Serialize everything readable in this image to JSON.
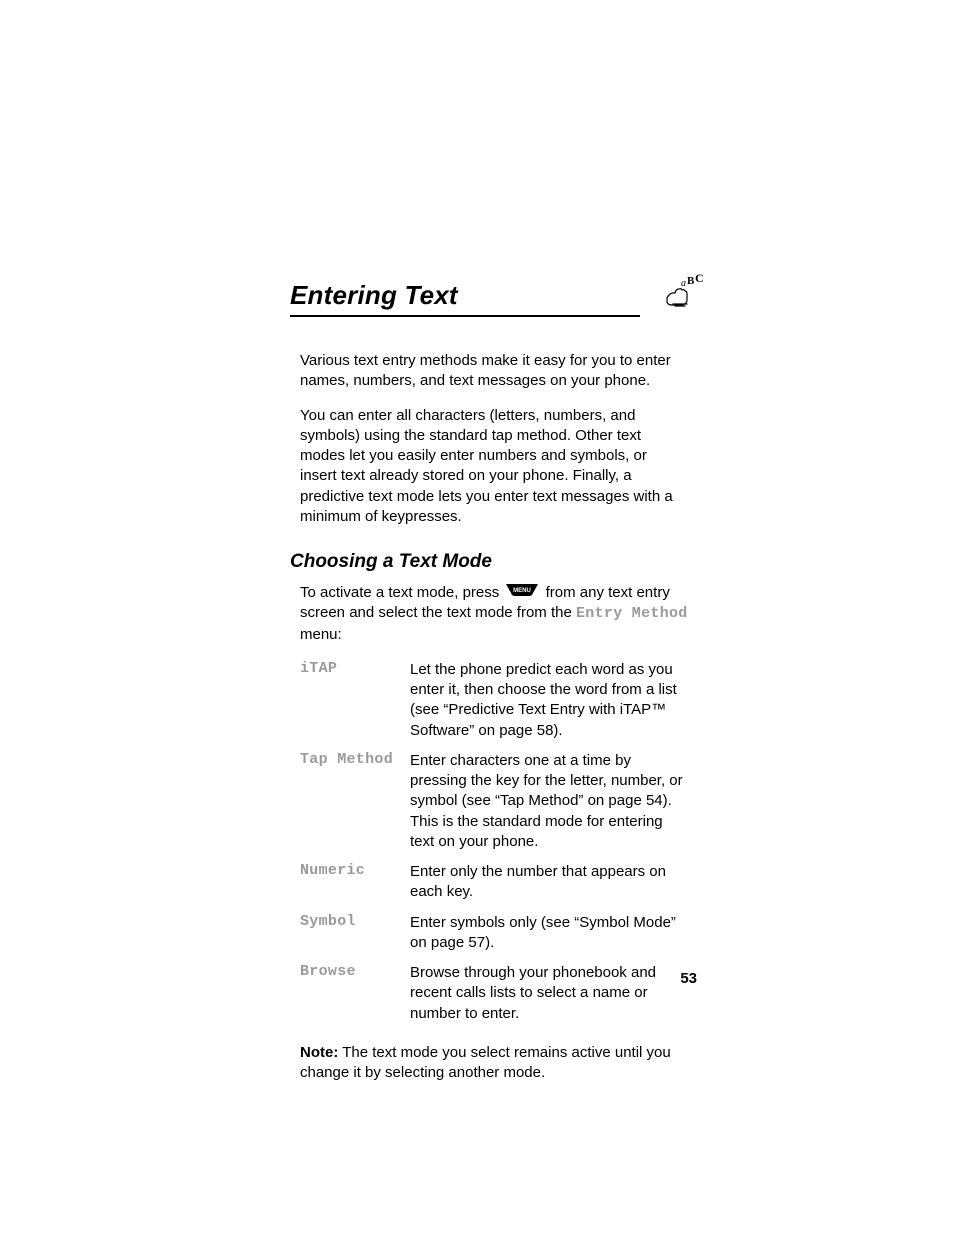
{
  "chapter": {
    "title": "Entering Text"
  },
  "intro": {
    "p1": "Various text entry methods make it easy for you to enter names, numbers, and text messages on your phone.",
    "p2": "You can enter all characters (letters, numbers, and symbols) using the standard tap method. Other text modes let you easily enter numbers and symbols, or insert text already stored on your phone. Finally, a predictive text mode lets you enter text messages with a minimum of keypresses."
  },
  "section": {
    "title": "Choosing a Text Mode",
    "lead_a": "To activate a text mode, press ",
    "lead_b": " from any text entry screen and select the text mode from the ",
    "lead_menu": "Entry Method",
    "lead_c": " menu:"
  },
  "modes": [
    {
      "term": "iTAP",
      "desc": "Let the phone predict each word as you enter it, then choose the word from a list (see “Predictive Text Entry with iTAP™ Software” on page 58)."
    },
    {
      "term": "Tap Method",
      "desc": "Enter characters one at a time by pressing the key for the letter, number, or symbol (see “Tap Method” on page 54). This is the standard mode for entering text on your phone."
    },
    {
      "term": "Numeric",
      "desc": "Enter only the number that appears on each key."
    },
    {
      "term": "Symbol",
      "desc": "Enter symbols only (see “Symbol Mode” on page 57)."
    },
    {
      "term": "Browse",
      "desc": "Browse through your phonebook and recent calls lists to select a name or number to enter."
    }
  ],
  "note": {
    "label": "Note:",
    "text": " The text mode you select remains active until you change it by selecting another mode."
  },
  "page_number": "53"
}
